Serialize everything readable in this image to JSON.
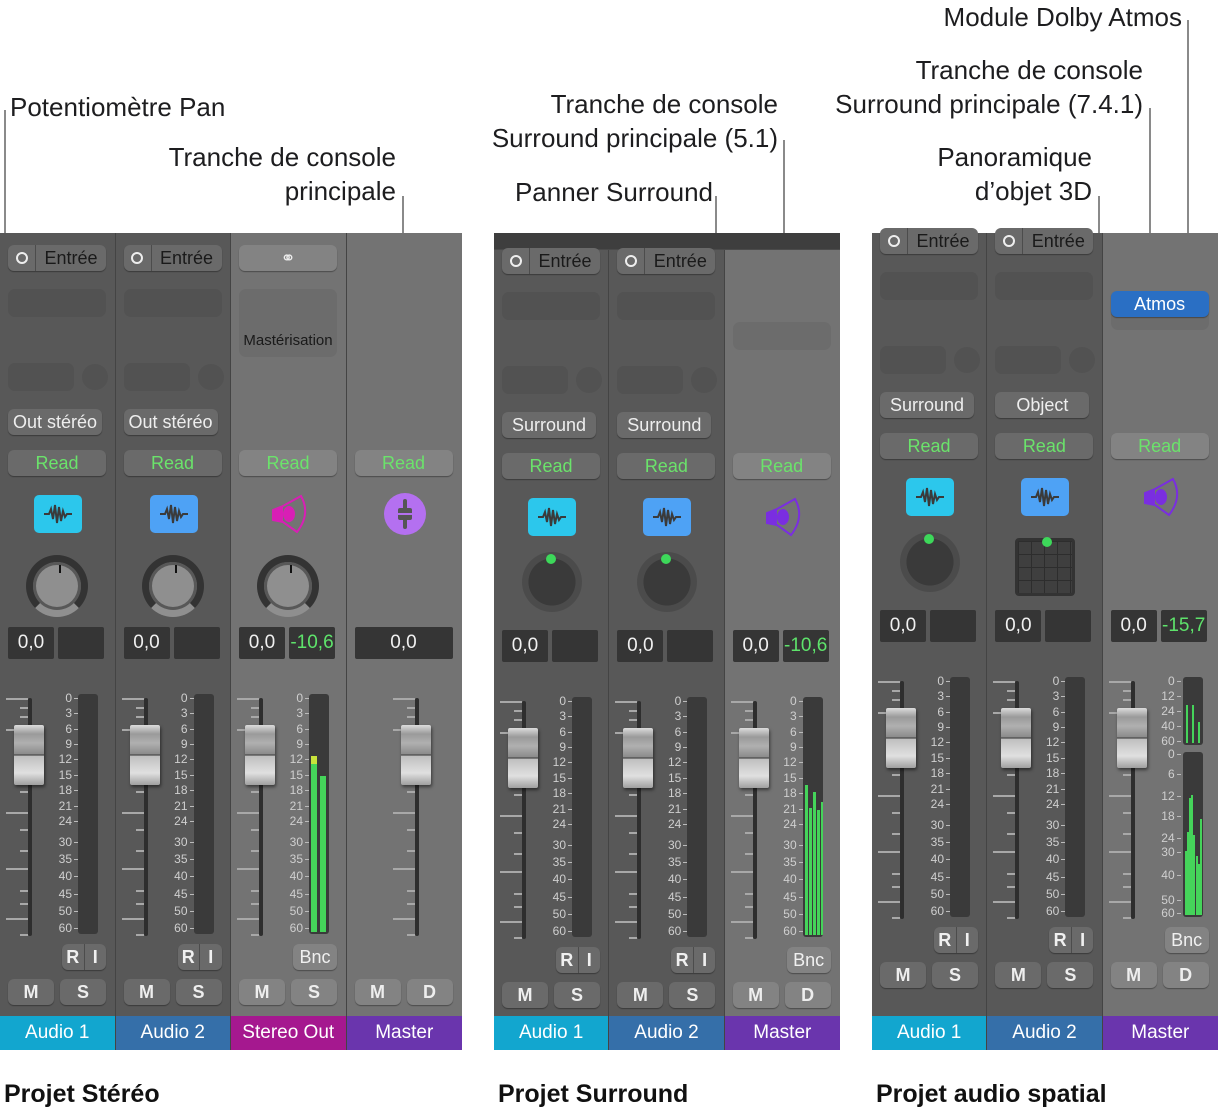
{
  "callouts": {
    "pan_knob": "Potentiomètre Pan",
    "main_strip_line1": "Tranche de console",
    "main_strip_line2": "principale",
    "surround_main_51_line1": "Tranche de console",
    "surround_main_51_line2": "Surround principale (5.1)",
    "surround_panner": "Panner Surround",
    "dolby_atmos_plugin": "Module Dolby Atmos",
    "surround_main_741_line1": "Tranche de console",
    "surround_main_741_line2": "Surround principale (7.4.1)",
    "object_panner_line1": "Panoramique",
    "object_panner_line2": "d’objet 3D"
  },
  "projects": [
    {
      "title": "Projet Stéréo",
      "strips": [
        {
          "name": "Audio 1",
          "color": "#12a6cf",
          "input": "Entrée",
          "output": "Out stéréo",
          "automation": "Read",
          "icon": "waveform-icon",
          "icon_color": "#2cc7ec",
          "panner": "knob",
          "volume": "0,0",
          "peak": "",
          "meter_levels_db": [],
          "bottom_button": [
            "R",
            "I"
          ],
          "mute": "M",
          "solo": "S"
        },
        {
          "name": "Audio 2",
          "color": "#356fa9",
          "input": "Entrée",
          "output": "Out stéréo",
          "automation": "Read",
          "icon": "waveform-icon",
          "icon_color": "#4ea2f5",
          "panner": "knob",
          "volume": "0,0",
          "peak": "",
          "meter_levels_db": [],
          "bottom_button": [
            "R",
            "I"
          ],
          "mute": "M",
          "solo": "S"
        },
        {
          "name": "Stereo Out",
          "color": "#a5188f",
          "link_icon": "stereo-link-icon",
          "plugin": "Mastérisation",
          "automation": "Read",
          "icon": "speaker-icon",
          "icon_color": "#d81fb5",
          "panner": "knob",
          "volume": "0,0",
          "peak": "-10,6",
          "meter_levels_db": [
            -10.6,
            -14.5
          ],
          "bottom_button": [
            "Bnc"
          ],
          "mute": "M",
          "solo": "S"
        },
        {
          "name": "Master",
          "color": "#6a35ad",
          "automation": "Read",
          "icon": "master-fader-icon",
          "icon_color": "#b470f0",
          "volume": "0,0",
          "mute": "M",
          "solo": "D"
        }
      ]
    },
    {
      "title": "Projet Surround",
      "strips": [
        {
          "name": "Audio 1",
          "color": "#12a6cf",
          "input": "Entrée",
          "output": "Surround",
          "automation": "Read",
          "icon": "waveform-icon",
          "icon_color": "#2cc7ec",
          "panner": "surround",
          "volume": "0,0",
          "peak": "",
          "bottom_button": [
            "R",
            "I"
          ],
          "mute": "M",
          "solo": "S"
        },
        {
          "name": "Audio 2",
          "color": "#356fa9",
          "input": "Entrée",
          "output": "Surround",
          "automation": "Read",
          "icon": "waveform-icon",
          "icon_color": "#4ea2f5",
          "panner": "surround",
          "volume": "0,0",
          "peak": "",
          "bottom_button": [
            "R",
            "I"
          ],
          "mute": "M",
          "solo": "S"
        },
        {
          "name": "Master",
          "color": "#6a35ad",
          "automation": "Read",
          "icon": "speaker-icon",
          "icon_color": "#7a2ee0",
          "volume": "0,0",
          "peak": "-10,6",
          "meter_levels_db": [
            -15.5,
            -20,
            -17,
            -20.5,
            -19,
            -41.5
          ],
          "bottom_button": [
            "Bnc"
          ],
          "mute": "M",
          "solo": "D"
        }
      ]
    },
    {
      "title": "Projet audio spatial",
      "strips": [
        {
          "name": "Audio 1",
          "color": "#12a6cf",
          "input": "Entrée",
          "output": "Surround",
          "automation": "Read",
          "icon": "waveform-icon",
          "icon_color": "#2cc7ec",
          "panner": "surround",
          "volume": "0,0",
          "peak": "",
          "bottom_button": [
            "R",
            "I"
          ],
          "mute": "M",
          "solo": "S"
        },
        {
          "name": "Audio 2",
          "color": "#356fa9",
          "input": "Entrée",
          "output": "Object",
          "automation": "Read",
          "icon": "waveform-icon",
          "icon_color": "#4ea2f5",
          "panner": "object-3d",
          "volume": "0,0",
          "peak": "",
          "bottom_button": [
            "R",
            "I"
          ],
          "mute": "M",
          "solo": "S"
        },
        {
          "name": "Master",
          "color": "#6a35ad",
          "plugin": "Atmos",
          "plugin_color": "#2a6fc4",
          "automation": "Read",
          "icon": "speaker-icon",
          "icon_color": "#7a2ee0",
          "volume": "0,0",
          "peak": "-15,7",
          "meter_top_levels_db": [
            -24,
            -24,
            -40,
            -40
          ],
          "meter_levels_db": [
            -36,
            -29,
            -16,
            -15,
            -30,
            -38,
            -41,
            -24
          ],
          "bottom_button": [
            "Bnc"
          ],
          "mute": "M",
          "solo": "D"
        }
      ]
    }
  ],
  "meter_scale": [
    "0",
    "3",
    "6",
    "9",
    "12",
    "15",
    "18",
    "21",
    "24",
    "30",
    "35",
    "40",
    "45",
    "50",
    "60"
  ],
  "meter_scale_atmos_top": [
    "0",
    "12",
    "24",
    "40",
    "60"
  ],
  "meter_scale_atmos_bottom": [
    "0",
    "6",
    "12",
    "18",
    "24",
    "30",
    "40",
    "50",
    "60"
  ]
}
